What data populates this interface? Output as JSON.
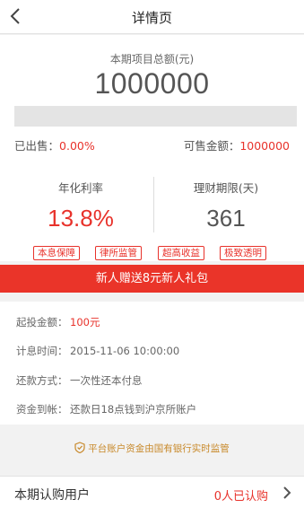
{
  "header": {
    "title": "详情页",
    "back_icon": "chevron-left-icon"
  },
  "summary": {
    "total_label": "本期项目总额(元)",
    "total_value": "1000000",
    "progress_fraction": 0.0,
    "sold_label": "已出售：",
    "sold_value": "0.00%",
    "available_label": "可售金额：",
    "available_value": "1000000"
  },
  "stats": {
    "rate_label": "年化利率",
    "rate_value": "13.8%",
    "term_label": "理财期限(天)",
    "term_value": "361"
  },
  "tags": [
    "本息保障",
    "律所监管",
    "超高收益",
    "极致透明"
  ],
  "banner": {
    "text": "新人赠送8元新人礼包"
  },
  "details": [
    {
      "key": "起投金额：",
      "value": "100元",
      "highlight": true
    },
    {
      "key": "计息时间：",
      "value": "2015-11-06 10:00:00",
      "highlight": false
    },
    {
      "key": "还款方式：",
      "value": "一次性还本付息",
      "highlight": false
    },
    {
      "key": "资金到帐：",
      "value": "还款日18点钱到沪京所账户",
      "highlight": false
    }
  ],
  "supervise": {
    "text": "平台账户资金由国有银行实时监管",
    "icon": "shield-check-icon"
  },
  "subscribers": {
    "label": "本期认购用户",
    "count_text": "0人已认购",
    "icon": "chevron-right-icon"
  },
  "colors": {
    "accent": "#e8322b",
    "banner": "#ea3429",
    "gold": "#c8892a"
  }
}
